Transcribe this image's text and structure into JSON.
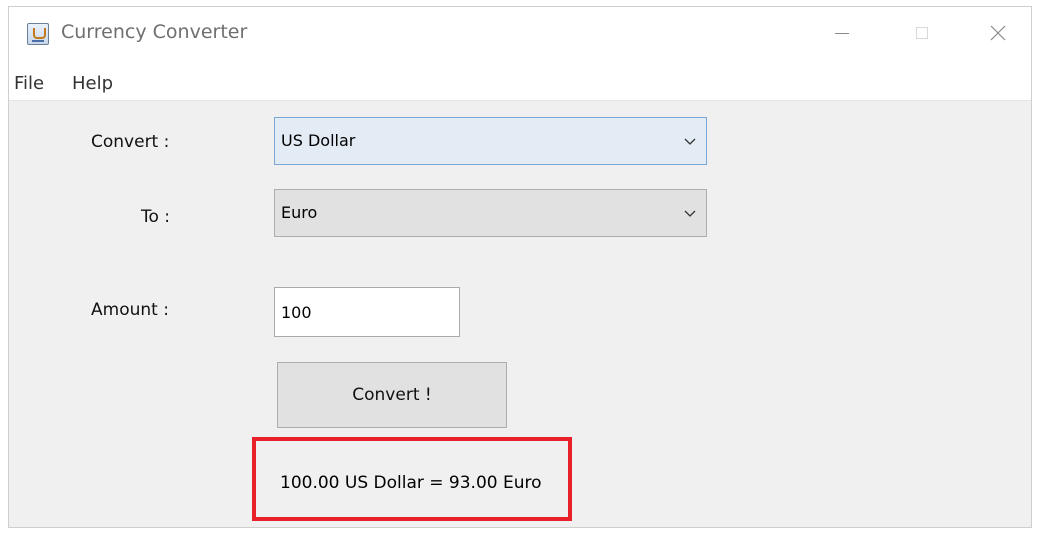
{
  "window": {
    "title": "Currency Converter",
    "icon": "java-app-icon"
  },
  "title_buttons": {
    "minimize": "minimize-icon",
    "maximize": "maximize-icon",
    "close": "close-icon"
  },
  "menu": {
    "items": [
      {
        "label": "File"
      },
      {
        "label": "Help"
      }
    ]
  },
  "form": {
    "convert_label": "Convert :",
    "from_currency": "US Dollar",
    "to_label": "To :",
    "to_currency": "Euro",
    "amount_label": "Amount :",
    "amount_value": "100",
    "convert_button": "Convert !"
  },
  "result": {
    "text": "100.00 US Dollar = 93.00 Euro",
    "highlight_color": "#e8202a"
  },
  "colors": {
    "window_bg": "#f0f0f0",
    "selected_combo_bg": "#e3ebf5",
    "button_bg": "#e1e1e1"
  }
}
